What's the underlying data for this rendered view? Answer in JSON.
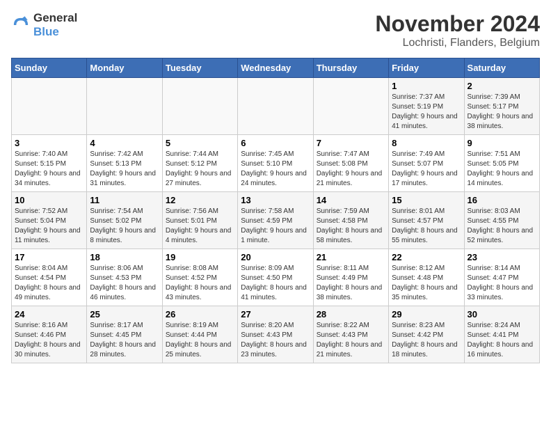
{
  "logo": {
    "line1": "General",
    "line2": "Blue"
  },
  "title": "November 2024",
  "location": "Lochristi, Flanders, Belgium",
  "headers": [
    "Sunday",
    "Monday",
    "Tuesday",
    "Wednesday",
    "Thursday",
    "Friday",
    "Saturday"
  ],
  "weeks": [
    [
      {
        "day": "",
        "info": ""
      },
      {
        "day": "",
        "info": ""
      },
      {
        "day": "",
        "info": ""
      },
      {
        "day": "",
        "info": ""
      },
      {
        "day": "",
        "info": ""
      },
      {
        "day": "1",
        "info": "Sunrise: 7:37 AM\nSunset: 5:19 PM\nDaylight: 9 hours and 41 minutes."
      },
      {
        "day": "2",
        "info": "Sunrise: 7:39 AM\nSunset: 5:17 PM\nDaylight: 9 hours and 38 minutes."
      }
    ],
    [
      {
        "day": "3",
        "info": "Sunrise: 7:40 AM\nSunset: 5:15 PM\nDaylight: 9 hours and 34 minutes."
      },
      {
        "day": "4",
        "info": "Sunrise: 7:42 AM\nSunset: 5:13 PM\nDaylight: 9 hours and 31 minutes."
      },
      {
        "day": "5",
        "info": "Sunrise: 7:44 AM\nSunset: 5:12 PM\nDaylight: 9 hours and 27 minutes."
      },
      {
        "day": "6",
        "info": "Sunrise: 7:45 AM\nSunset: 5:10 PM\nDaylight: 9 hours and 24 minutes."
      },
      {
        "day": "7",
        "info": "Sunrise: 7:47 AM\nSunset: 5:08 PM\nDaylight: 9 hours and 21 minutes."
      },
      {
        "day": "8",
        "info": "Sunrise: 7:49 AM\nSunset: 5:07 PM\nDaylight: 9 hours and 17 minutes."
      },
      {
        "day": "9",
        "info": "Sunrise: 7:51 AM\nSunset: 5:05 PM\nDaylight: 9 hours and 14 minutes."
      }
    ],
    [
      {
        "day": "10",
        "info": "Sunrise: 7:52 AM\nSunset: 5:04 PM\nDaylight: 9 hours and 11 minutes."
      },
      {
        "day": "11",
        "info": "Sunrise: 7:54 AM\nSunset: 5:02 PM\nDaylight: 9 hours and 8 minutes."
      },
      {
        "day": "12",
        "info": "Sunrise: 7:56 AM\nSunset: 5:01 PM\nDaylight: 9 hours and 4 minutes."
      },
      {
        "day": "13",
        "info": "Sunrise: 7:58 AM\nSunset: 4:59 PM\nDaylight: 9 hours and 1 minute."
      },
      {
        "day": "14",
        "info": "Sunrise: 7:59 AM\nSunset: 4:58 PM\nDaylight: 8 hours and 58 minutes."
      },
      {
        "day": "15",
        "info": "Sunrise: 8:01 AM\nSunset: 4:57 PM\nDaylight: 8 hours and 55 minutes."
      },
      {
        "day": "16",
        "info": "Sunrise: 8:03 AM\nSunset: 4:55 PM\nDaylight: 8 hours and 52 minutes."
      }
    ],
    [
      {
        "day": "17",
        "info": "Sunrise: 8:04 AM\nSunset: 4:54 PM\nDaylight: 8 hours and 49 minutes."
      },
      {
        "day": "18",
        "info": "Sunrise: 8:06 AM\nSunset: 4:53 PM\nDaylight: 8 hours and 46 minutes."
      },
      {
        "day": "19",
        "info": "Sunrise: 8:08 AM\nSunset: 4:52 PM\nDaylight: 8 hours and 43 minutes."
      },
      {
        "day": "20",
        "info": "Sunrise: 8:09 AM\nSunset: 4:50 PM\nDaylight: 8 hours and 41 minutes."
      },
      {
        "day": "21",
        "info": "Sunrise: 8:11 AM\nSunset: 4:49 PM\nDaylight: 8 hours and 38 minutes."
      },
      {
        "day": "22",
        "info": "Sunrise: 8:12 AM\nSunset: 4:48 PM\nDaylight: 8 hours and 35 minutes."
      },
      {
        "day": "23",
        "info": "Sunrise: 8:14 AM\nSunset: 4:47 PM\nDaylight: 8 hours and 33 minutes."
      }
    ],
    [
      {
        "day": "24",
        "info": "Sunrise: 8:16 AM\nSunset: 4:46 PM\nDaylight: 8 hours and 30 minutes."
      },
      {
        "day": "25",
        "info": "Sunrise: 8:17 AM\nSunset: 4:45 PM\nDaylight: 8 hours and 28 minutes."
      },
      {
        "day": "26",
        "info": "Sunrise: 8:19 AM\nSunset: 4:44 PM\nDaylight: 8 hours and 25 minutes."
      },
      {
        "day": "27",
        "info": "Sunrise: 8:20 AM\nSunset: 4:43 PM\nDaylight: 8 hours and 23 minutes."
      },
      {
        "day": "28",
        "info": "Sunrise: 8:22 AM\nSunset: 4:43 PM\nDaylight: 8 hours and 21 minutes."
      },
      {
        "day": "29",
        "info": "Sunrise: 8:23 AM\nSunset: 4:42 PM\nDaylight: 8 hours and 18 minutes."
      },
      {
        "day": "30",
        "info": "Sunrise: 8:24 AM\nSunset: 4:41 PM\nDaylight: 8 hours and 16 minutes."
      }
    ]
  ]
}
